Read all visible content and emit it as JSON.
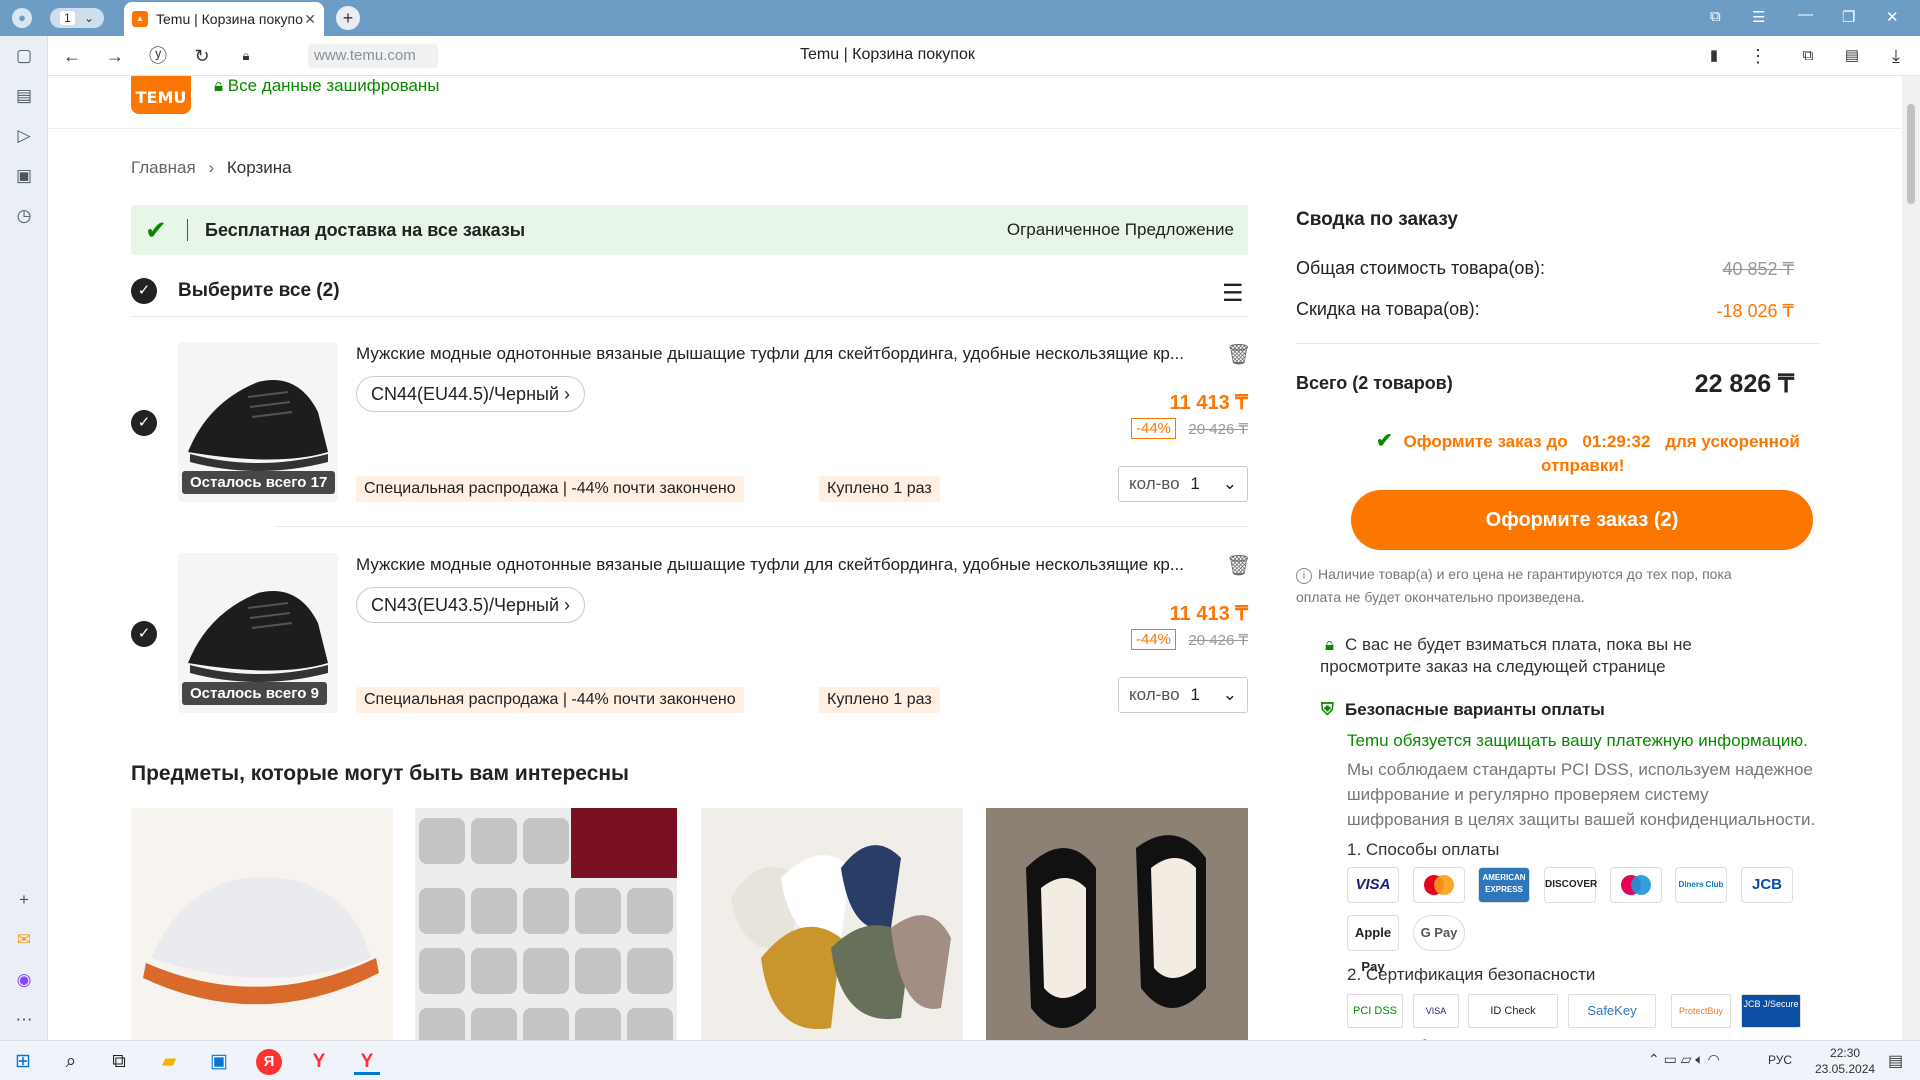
{
  "browser": {
    "tab_count": "1",
    "tab_title": "Temu | Корзина покупо",
    "url": "www.temu.com",
    "page_title": "Temu | Корзина покупок"
  },
  "header": {
    "logo_text": "TEMU",
    "secure_text": "Все данные зашифрованы"
  },
  "breadcrumb": {
    "home": "Главная",
    "sep": "›",
    "current": "Корзина"
  },
  "promo": {
    "left": "Бесплатная доставка на все заказы",
    "right": "Ограниченное Предложение"
  },
  "select_all": "Выберите все (2)",
  "items": [
    {
      "title": "Мужские модные однотонные вязаные дышащие туфли для скейтбординга, удобные нескользящие кр...",
      "variant": "CN44(EU44.5)/Черный",
      "stock_badge": "Осталось всего 17",
      "price": "11 413 ₸",
      "discount": "-44%",
      "old_price": "20 426 ₸",
      "tag_sale": "Специальная распродажа | -44% почти закончено",
      "tag_bought": "Куплено 1 раз",
      "qty_label": "кол-во",
      "qty": "1"
    },
    {
      "title": "Мужские модные однотонные вязаные дышащие туфли для скейтбординга, удобные нескользящие кр...",
      "variant": "CN43(EU43.5)/Черный",
      "stock_badge": "Осталось всего 9",
      "price": "11 413 ₸",
      "discount": "-44%",
      "old_price": "20 426 ₸",
      "tag_sale": "Специальная распродажа | -44% почти закончено",
      "tag_bought": "Куплено 1 раз",
      "qty_label": "кол-во",
      "qty": "1"
    }
  ],
  "recommended_title": "Предметы, которые могут быть вам интересны",
  "summary": {
    "title": "Сводка по заказу",
    "subtotal_label": "Общая стоимость товара(ов):",
    "subtotal_value": "40 852 ₸",
    "discount_label": "Скидка на товара(ов):",
    "discount_value": "-18 026 ₸",
    "total_label": "Всего (2 товаров)",
    "total_value": "22 826 ₸",
    "timer_pre": "Оформите заказ до",
    "timer": "01:29:32",
    "timer_post": "для ускоренной",
    "timer_post2": "отправки!",
    "checkout_button": "Оформите заказ (2)",
    "note_info_1": "Наличие товар(а) и его цена не гарантируются до тех пор, пока",
    "note_info_2": "оплата не будет окончательно произведена.",
    "note_charge_1": "С вас не будет взиматься плата, пока вы не",
    "note_charge_2": "просмотрите заказ на следующей странице",
    "secure_title": "Безопасные варианты оплаты",
    "secure_green": "Temu обязуется защищать вашу платежную информацию.",
    "secure_desc_1": "Мы соблюдаем стандарты PCI DSS, используем надежное",
    "secure_desc_2": "шифрование и регулярно проверяем систему",
    "secure_desc_3": "шифрования в целях защиты вашей конфиденциальности.",
    "pay_methods_title": "1. Способы оплаты",
    "pay_methods": [
      "VISA",
      "mastercard",
      "AMERICAN EXPRESS",
      "DISCOVER",
      "maestro",
      "Diners Club",
      "JCB",
      "Apple Pay",
      "G Pay"
    ],
    "cert_title": "2. Сертификация безопасности",
    "certs": [
      "PCI DSS",
      "VISA Secure",
      "ID Check",
      "SafeKey",
      "ProtectBuy",
      "JCB J/Secure"
    ]
  },
  "taskbar": {
    "lang": "РУС",
    "time": "22:30",
    "date": "23.05.2024"
  },
  "colors": {
    "accent": "#fb7701",
    "green": "#0a8800",
    "chrome_blue": "#6d9dc5"
  }
}
